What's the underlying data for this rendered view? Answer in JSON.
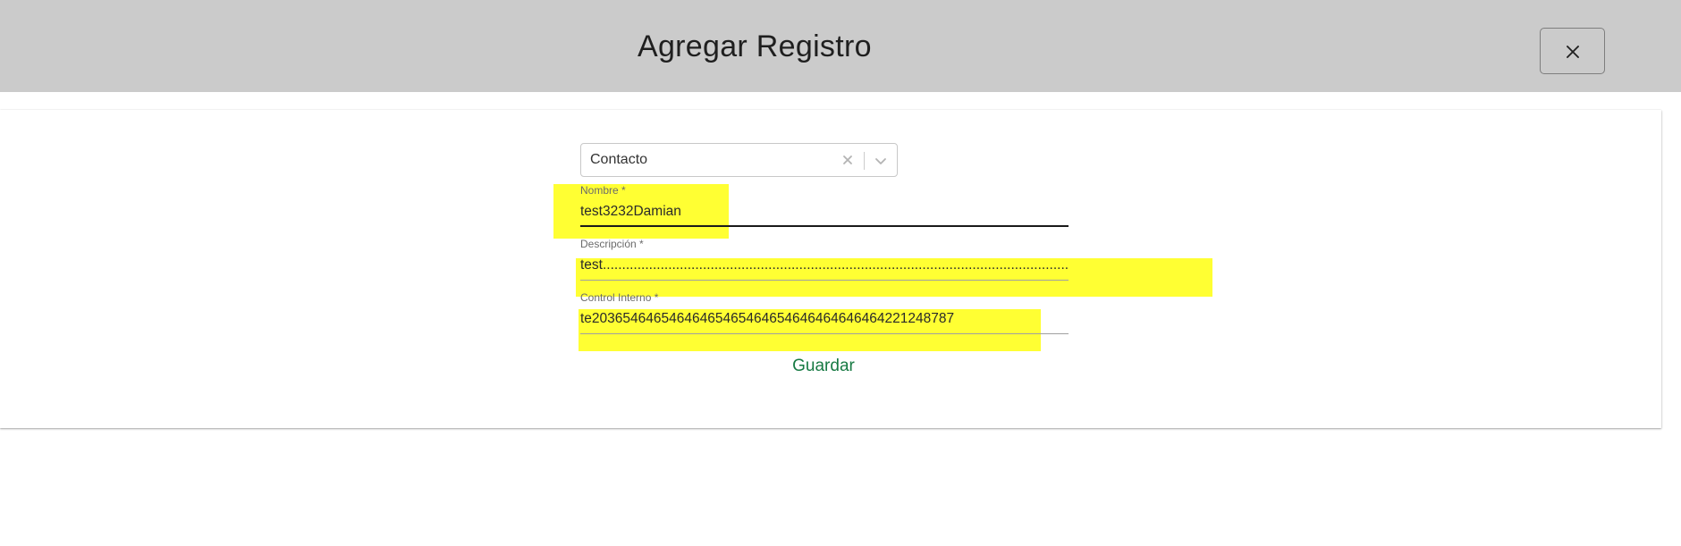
{
  "header": {
    "title": "Agregar Registro",
    "close_icon": "close-icon"
  },
  "form": {
    "tipo_select": {
      "value": "Contacto",
      "clear_icon": "clear-x-icon",
      "dropdown_icon": "chevron-down-icon"
    },
    "nombre": {
      "label": "Nombre *",
      "value": "test3232Damian"
    },
    "descripcion": {
      "label": "Descripción *",
      "value": "test.........................................................................................................................................."
    },
    "control_interno": {
      "label": "Control Interno *",
      "value": "te20365464654646465465464654646464646464221248787"
    },
    "submit_label": "Guardar"
  },
  "colors": {
    "header_bg": "#cbcbcb",
    "highlight": "#ffff33",
    "accent_green": "#177a43"
  }
}
